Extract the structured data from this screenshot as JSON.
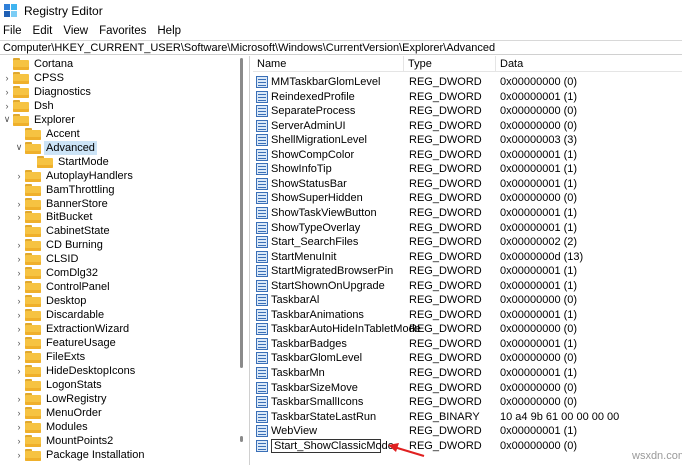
{
  "window": {
    "title": "Registry Editor",
    "icon": "registry-app-icon"
  },
  "menu": [
    "File",
    "Edit",
    "View",
    "Favorites",
    "Help"
  ],
  "address": "Computer\\HKEY_CURRENT_USER\\Software\\Microsoft\\Windows\\CurrentVersion\\Explorer\\Advanced",
  "tree": [
    {
      "label": "Cortana",
      "chevron": "none"
    },
    {
      "label": "CPSS",
      "chevron": ">"
    },
    {
      "label": "Diagnostics",
      "chevron": ">"
    },
    {
      "label": "Dsh",
      "chevron": ">"
    },
    {
      "label": "Explorer",
      "chevron": "v"
    },
    {
      "label": "Accent",
      "chevron": "none"
    },
    {
      "label": "Advanced",
      "chevron": "v",
      "selected": true
    },
    {
      "label": "StartMode",
      "chevron": "none"
    },
    {
      "label": "AutoplayHandlers",
      "chevron": ">"
    },
    {
      "label": "BamThrottling",
      "chevron": "none"
    },
    {
      "label": "BannerStore",
      "chevron": ">"
    },
    {
      "label": "BitBucket",
      "chevron": ">"
    },
    {
      "label": "CabinetState",
      "chevron": "none"
    },
    {
      "label": "CD Burning",
      "chevron": ">"
    },
    {
      "label": "CLSID",
      "chevron": ">"
    },
    {
      "label": "ComDlg32",
      "chevron": ">"
    },
    {
      "label": "ControlPanel",
      "chevron": ">"
    },
    {
      "label": "Desktop",
      "chevron": ">"
    },
    {
      "label": "Discardable",
      "chevron": ">"
    },
    {
      "label": "ExtractionWizard",
      "chevron": ">"
    },
    {
      "label": "FeatureUsage",
      "chevron": ">"
    },
    {
      "label": "FileExts",
      "chevron": ">"
    },
    {
      "label": "HideDesktopIcons",
      "chevron": ">"
    },
    {
      "label": "LogonStats",
      "chevron": "none"
    },
    {
      "label": "LowRegistry",
      "chevron": ">"
    },
    {
      "label": "MenuOrder",
      "chevron": ">"
    },
    {
      "label": "Modules",
      "chevron": ">"
    },
    {
      "label": "MountPoints2",
      "chevron": ">"
    },
    {
      "label": "Package Installation",
      "chevron": ">"
    }
  ],
  "columns": {
    "name": "Name",
    "type": "Type",
    "data": "Data"
  },
  "values": [
    {
      "name": "MMTaskbarGlomLevel",
      "type": "REG_DWORD",
      "data": "0x00000000 (0)"
    },
    {
      "name": "ReindexedProfile",
      "type": "REG_DWORD",
      "data": "0x00000001 (1)"
    },
    {
      "name": "SeparateProcess",
      "type": "REG_DWORD",
      "data": "0x00000000 (0)"
    },
    {
      "name": "ServerAdminUI",
      "type": "REG_DWORD",
      "data": "0x00000000 (0)"
    },
    {
      "name": "ShellMigrationLevel",
      "type": "REG_DWORD",
      "data": "0x00000003 (3)"
    },
    {
      "name": "ShowCompColor",
      "type": "REG_DWORD",
      "data": "0x00000001 (1)"
    },
    {
      "name": "ShowInfoTip",
      "type": "REG_DWORD",
      "data": "0x00000001 (1)"
    },
    {
      "name": "ShowStatusBar",
      "type": "REG_DWORD",
      "data": "0x00000001 (1)"
    },
    {
      "name": "ShowSuperHidden",
      "type": "REG_DWORD",
      "data": "0x00000000 (0)"
    },
    {
      "name": "ShowTaskViewButton",
      "type": "REG_DWORD",
      "data": "0x00000001 (1)"
    },
    {
      "name": "ShowTypeOverlay",
      "type": "REG_DWORD",
      "data": "0x00000001 (1)"
    },
    {
      "name": "Start_SearchFiles",
      "type": "REG_DWORD",
      "data": "0x00000002 (2)"
    },
    {
      "name": "StartMenuInit",
      "type": "REG_DWORD",
      "data": "0x0000000d (13)"
    },
    {
      "name": "StartMigratedBrowserPin",
      "type": "REG_DWORD",
      "data": "0x00000001 (1)"
    },
    {
      "name": "StartShownOnUpgrade",
      "type": "REG_DWORD",
      "data": "0x00000001 (1)"
    },
    {
      "name": "TaskbarAl",
      "type": "REG_DWORD",
      "data": "0x00000000 (0)"
    },
    {
      "name": "TaskbarAnimations",
      "type": "REG_DWORD",
      "data": "0x00000001 (1)"
    },
    {
      "name": "TaskbarAutoHideInTabletMode",
      "type": "REG_DWORD",
      "data": "0x00000000 (0)"
    },
    {
      "name": "TaskbarBadges",
      "type": "REG_DWORD",
      "data": "0x00000001 (1)"
    },
    {
      "name": "TaskbarGlomLevel",
      "type": "REG_DWORD",
      "data": "0x00000000 (0)"
    },
    {
      "name": "TaskbarMn",
      "type": "REG_DWORD",
      "data": "0x00000001 (1)"
    },
    {
      "name": "TaskbarSizeMove",
      "type": "REG_DWORD",
      "data": "0x00000000 (0)"
    },
    {
      "name": "TaskbarSmallIcons",
      "type": "REG_DWORD",
      "data": "0x00000000 (0)"
    },
    {
      "name": "TaskbarStateLastRun",
      "type": "REG_BINARY",
      "data": "10 a4 9b 61 00 00 00 00"
    },
    {
      "name": "WebView",
      "type": "REG_DWORD",
      "data": "0x00000001 (1)"
    },
    {
      "name": "Start_ShowClassicMode",
      "type": "REG_DWORD",
      "data": "0x00000000 (0)",
      "editing": true
    }
  ],
  "annotation": {
    "arrow_color": "#e02020"
  },
  "watermark": "wsxdn.com"
}
